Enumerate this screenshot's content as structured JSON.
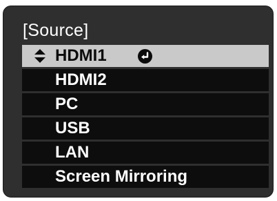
{
  "window": {
    "title": "[Source]"
  },
  "menu": {
    "items": [
      {
        "label": "HDMI1",
        "selected": true
      },
      {
        "label": "HDMI2"
      },
      {
        "label": "PC"
      },
      {
        "label": "USB"
      },
      {
        "label": "LAN"
      },
      {
        "label": "Screen Mirroring"
      }
    ],
    "icons": {
      "updown": "up-down-arrow-icon",
      "enter": "enter-return-icon"
    }
  },
  "colors": {
    "background": "#2f2f2f",
    "item": "#0d0d0d",
    "selected": "#c9c9c9",
    "text": "#ffffff",
    "selected_text": "#0b0b0b"
  }
}
